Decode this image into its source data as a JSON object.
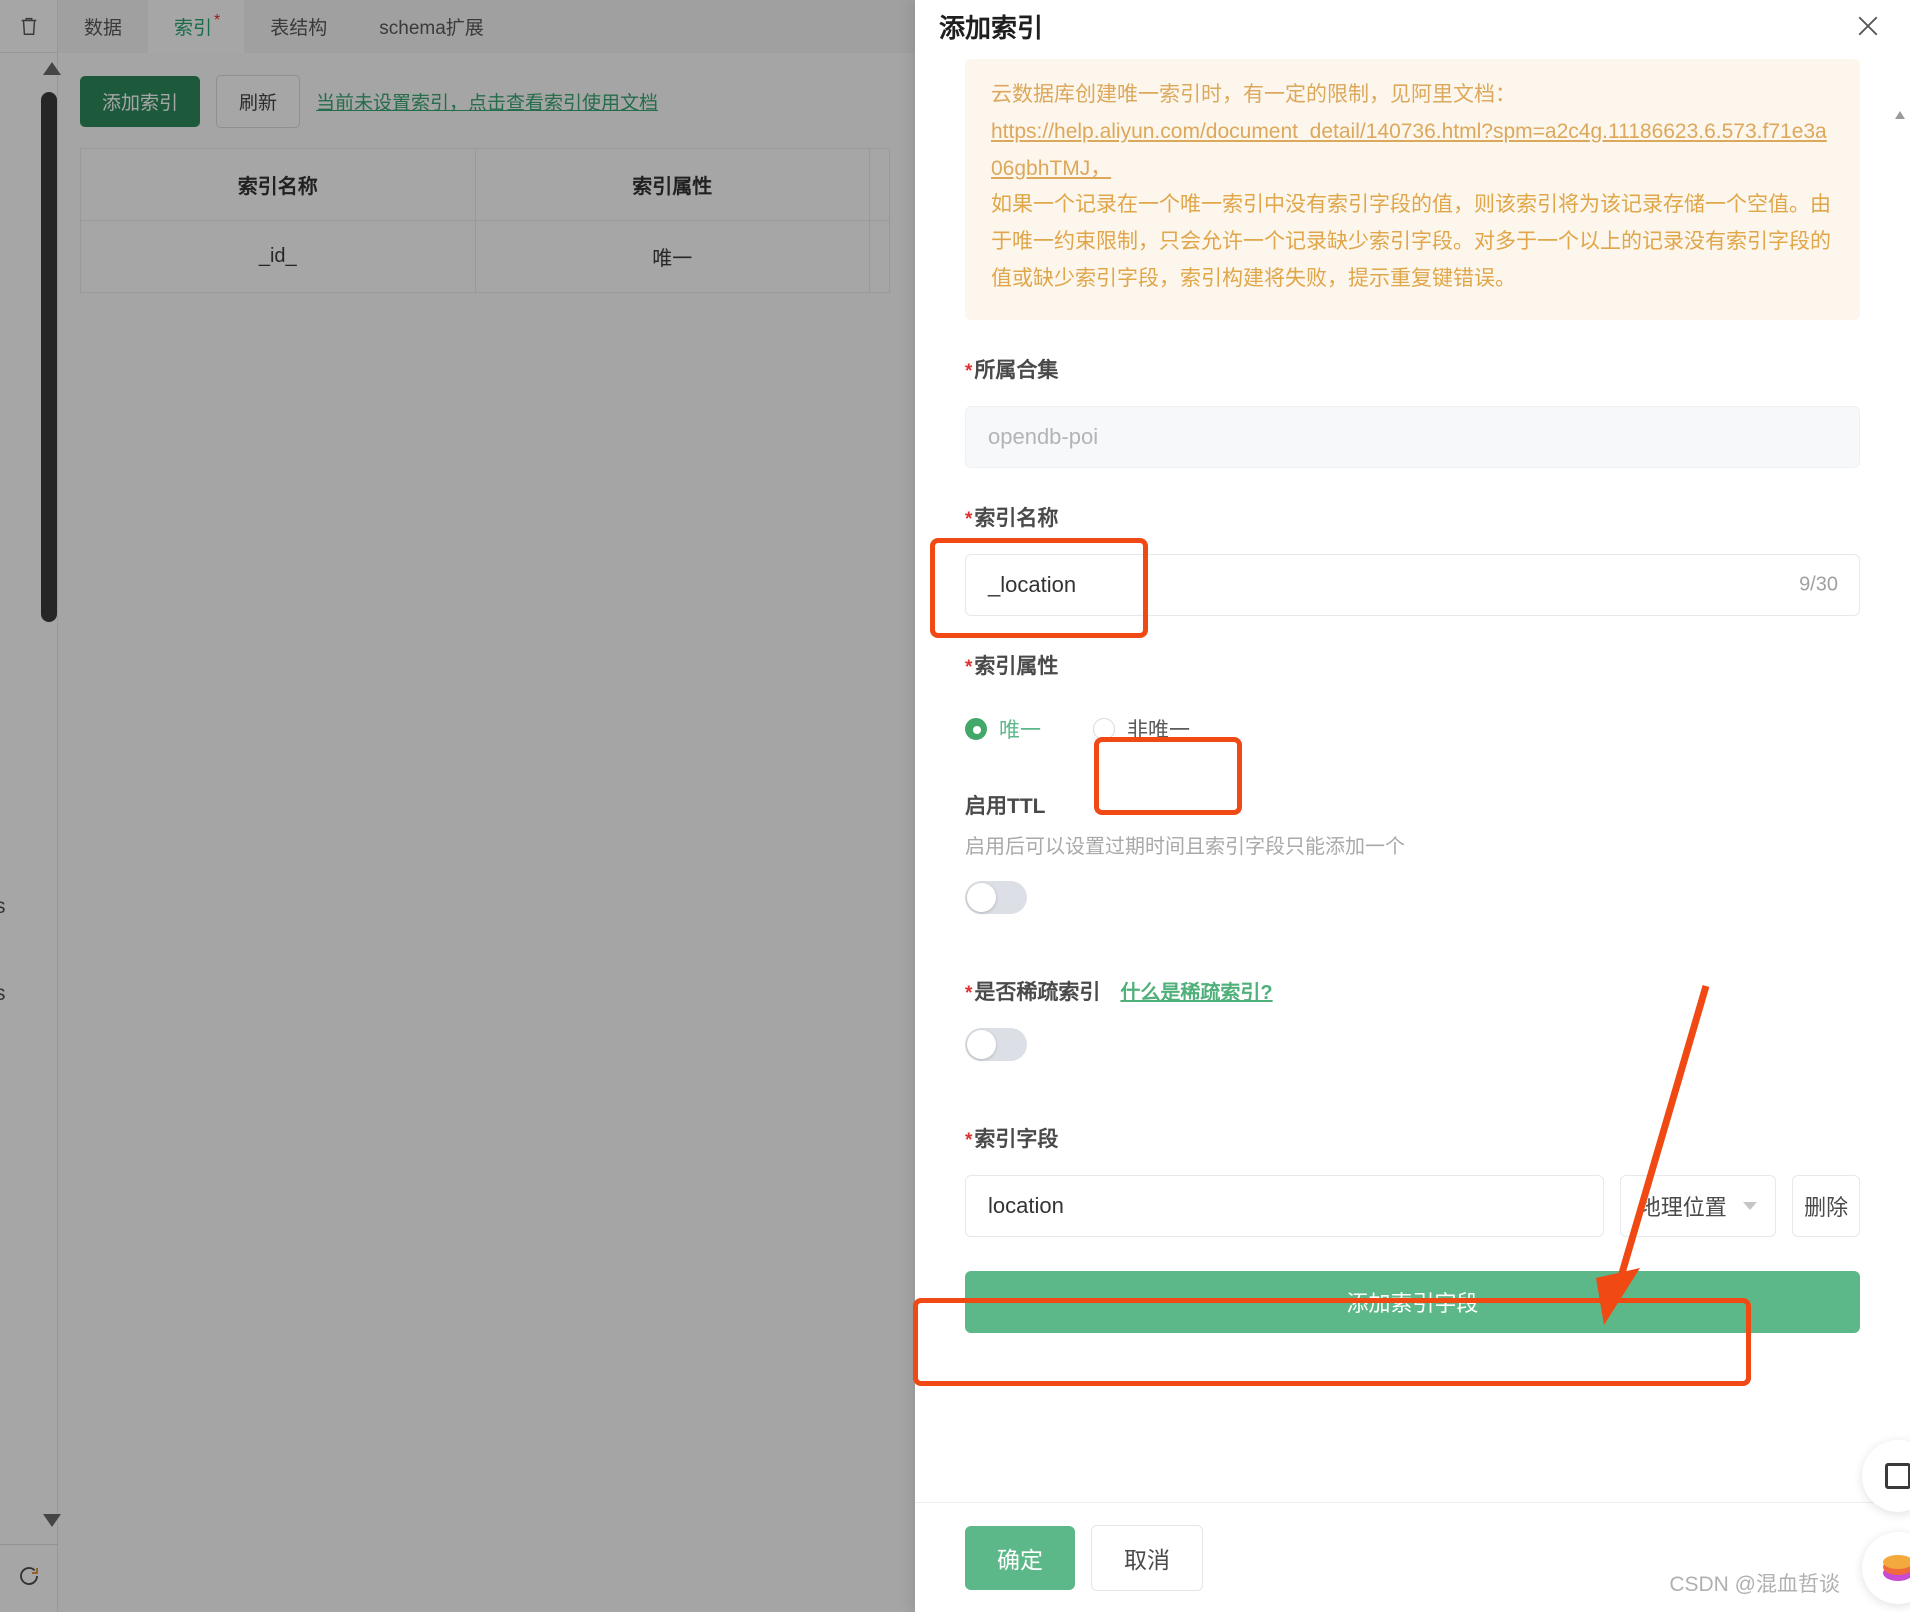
{
  "background": {
    "rail": {
      "trash_icon": "trash-icon",
      "refresh_icon": "refresh-icon"
    },
    "tabs": [
      {
        "label": "数据",
        "active": false,
        "star": ""
      },
      {
        "label": "索引",
        "active": true,
        "star": "*"
      },
      {
        "label": "表结构",
        "active": false,
        "star": ""
      },
      {
        "label": "schema扩展",
        "active": false,
        "star": ""
      }
    ],
    "toolbar": {
      "add_index": "添加索引",
      "refresh": "刷新",
      "doc_link": "当前未设置索引，点击查看索引使用文档"
    },
    "table": {
      "headers": [
        "索引名称",
        "索引属性"
      ],
      "rows": [
        [
          "_id_",
          "唯一"
        ]
      ]
    },
    "edge_text_1": "s",
    "edge_text_2": "s"
  },
  "modal": {
    "title": "添加索引",
    "close_icon": "close-icon",
    "alert": {
      "line_top_clipped": "云数据库创建唯一索引时，有一定的限制，见阿里文档：",
      "link": "https://help.aliyun.com/document_detail/140736.html?spm=a2c4g.11186623.6.573.f71e3a06gbhTMJ，",
      "paragraph": "如果一个记录在一个唯一索引中没有索引字段的值，则该索引将为该记录存储一个空值。由于唯一约束限制，只会允许一个记录缺少索引字段。对多于一个以上的记录没有索引字段的值或缺少索引字段，索引构建将失败，提示重复键错误。"
    },
    "collection": {
      "label": "所属合集",
      "required": "*",
      "value": "opendb-poi"
    },
    "index_name": {
      "label": "索引名称",
      "required": "*",
      "value": "_location",
      "counter": "9/30"
    },
    "index_property": {
      "label": "索引属性",
      "required": "*",
      "options": [
        {
          "label": "唯一",
          "selected": true
        },
        {
          "label": "非唯一",
          "selected": false
        }
      ]
    },
    "ttl": {
      "label": "启用TTL",
      "description": "启用后可以设置过期时间且索引字段只能添加一个",
      "enabled": false
    },
    "sparse": {
      "label": "是否稀疏索引",
      "required": "*",
      "help_link": "什么是稀疏索引?",
      "enabled": false
    },
    "index_fields": {
      "label": "索引字段",
      "required": "*",
      "rows": [
        {
          "name": "location",
          "type": "地理位置",
          "delete_label": "删除"
        }
      ],
      "add_button": "添加索引字段"
    },
    "footer": {
      "confirm": "确定",
      "cancel": "取消"
    }
  },
  "watermark": "CSDN @混血哲谈",
  "colors": {
    "accent_green": "#5cb888",
    "dark_green": "#2d8a5c",
    "annotation_red": "#f04913",
    "alert_bg": "#fdf6ec",
    "alert_text": "#e0a64a"
  }
}
